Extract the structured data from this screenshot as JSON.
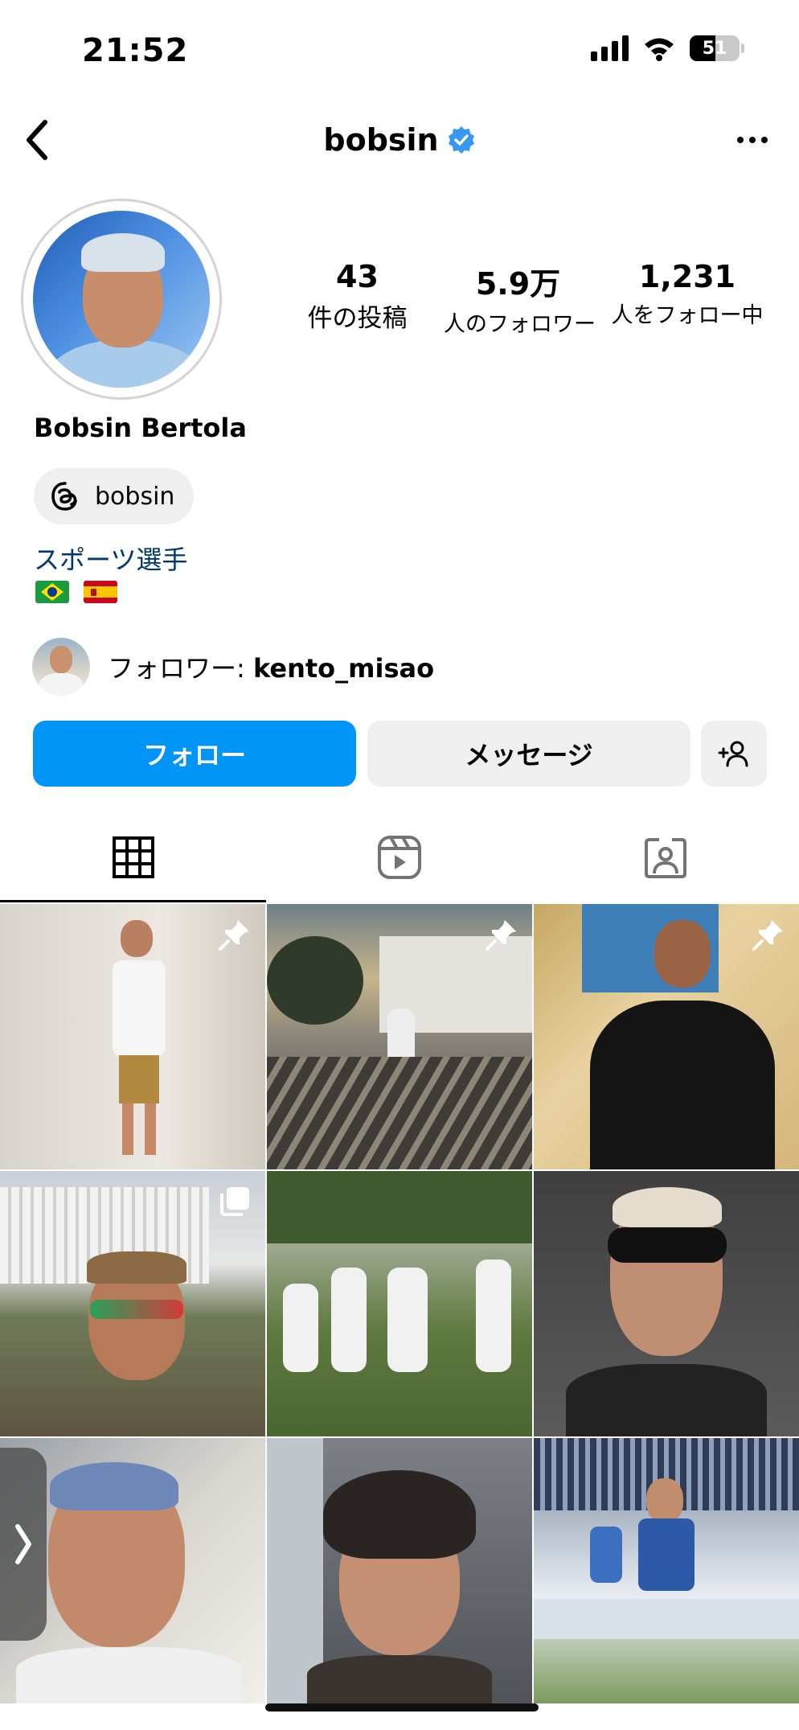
{
  "status_bar": {
    "time": "21:52",
    "battery_level": "51",
    "icons": [
      "cellular-signal-icon",
      "wifi-icon",
      "battery-icon"
    ]
  },
  "header": {
    "username": "bobsin",
    "verified": true,
    "back_icon": "chevron-left-icon",
    "more_icon": "more-horizontal-icon"
  },
  "profile": {
    "full_name": "Bobsin Bertola",
    "threads_handle": "bobsin",
    "category": "スポーツ選手",
    "flags": [
      "flag-brazil",
      "flag-spain"
    ],
    "stats": [
      {
        "value": "43",
        "label": "件の投稿"
      },
      {
        "value": "5.9万",
        "label": "人のフォロワー"
      },
      {
        "value": "1,231",
        "label": "人をフォロー中"
      }
    ],
    "followed_by_prefix": "フォロワー: ",
    "followed_by_user": "kento_misao"
  },
  "actions": {
    "follow_label": "フォロー",
    "message_label": "メッセージ",
    "add_user_icon": "add-person-icon"
  },
  "tabs": [
    {
      "name": "posts",
      "icon": "grid-icon",
      "active": true
    },
    {
      "name": "reels",
      "icon": "reels-icon",
      "active": false
    },
    {
      "name": "tagged",
      "icon": "tagged-person-icon",
      "active": false
    }
  ],
  "posts": [
    {
      "badge": "pin-icon"
    },
    {
      "badge": "pin-icon"
    },
    {
      "badge": "pin-icon"
    },
    {
      "badge": "carousel-icon"
    },
    {
      "badge": ""
    },
    {
      "badge": ""
    },
    {
      "badge": ""
    },
    {
      "badge": ""
    },
    {
      "badge": ""
    }
  ],
  "colors": {
    "follow_button": "#0095f6",
    "secondary_button": "#efefef",
    "verified_badge": "#3897f0",
    "category_text": "#00376b"
  }
}
